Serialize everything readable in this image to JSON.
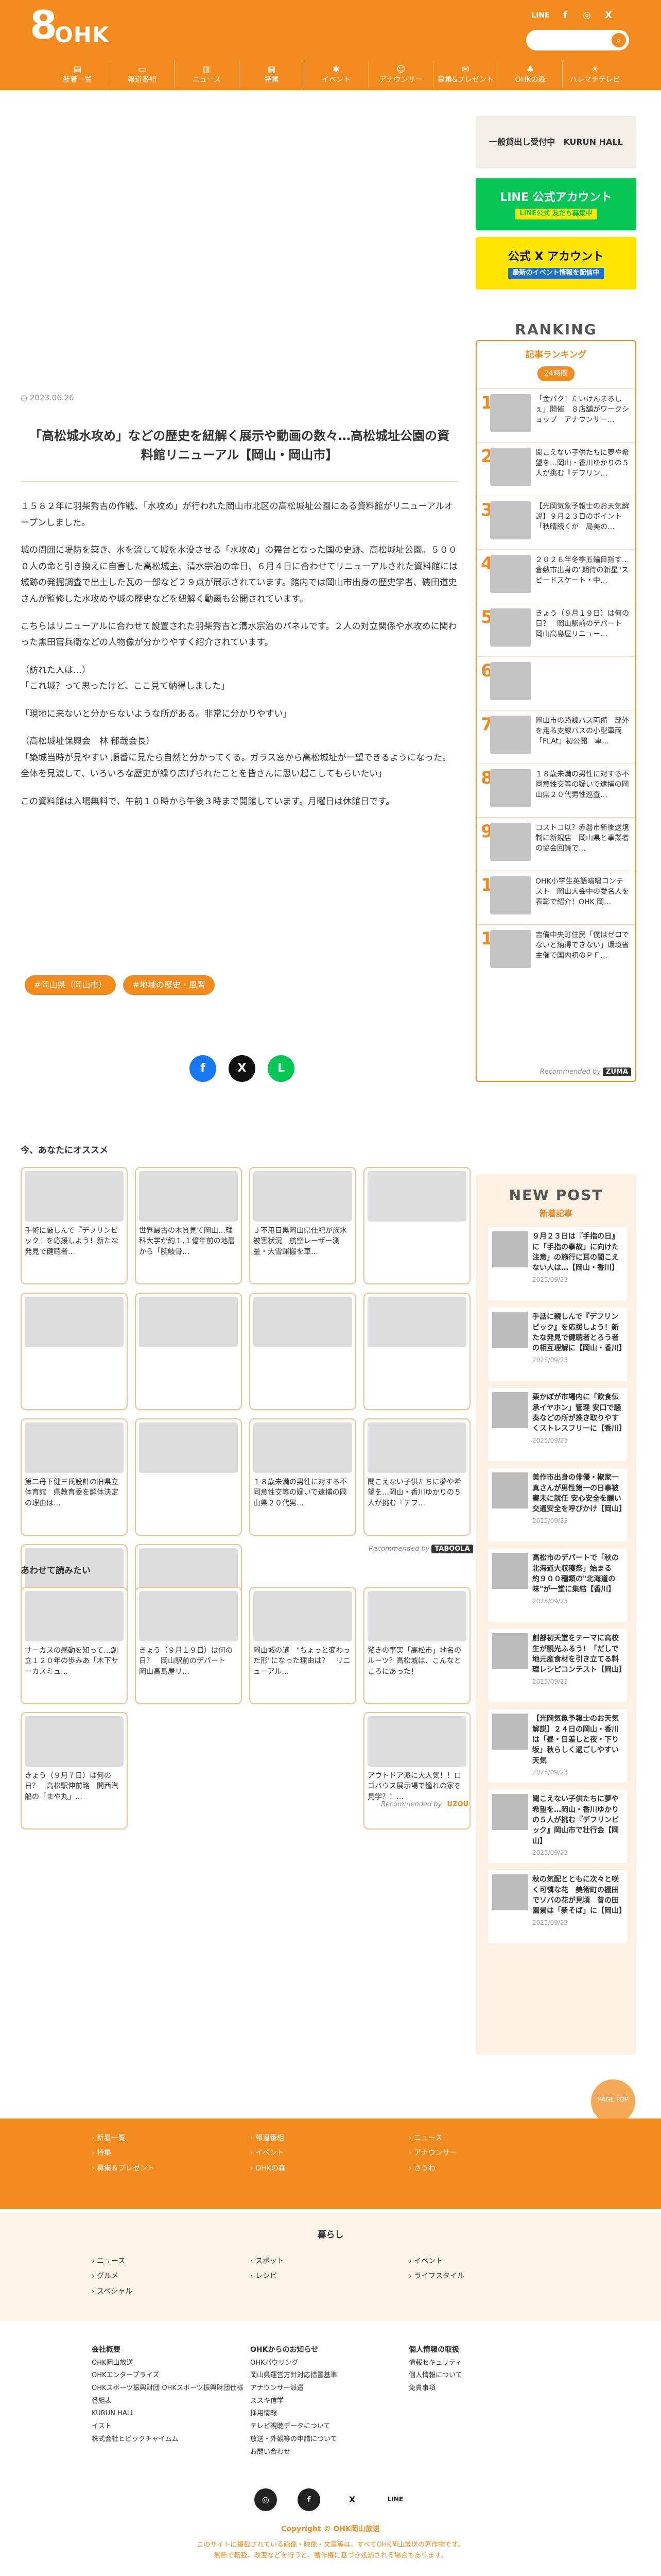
{
  "header": {
    "logo_num": "8",
    "logo_text": "OHK",
    "line": "LINE",
    "facebook": "f",
    "instagram": "◎",
    "x": "X",
    "nav": [
      "新着一覧",
      "報道番組",
      "ニュース",
      "特集",
      "イベント",
      "アナウンサー",
      "募集&プレゼント",
      "OHKの森",
      "ハレマチテレビ"
    ]
  },
  "article": {
    "date": "2023.06.26",
    "title": "「高松城水攻め」などの歴史を紐解く展示や動画の数々…高松城址公園の資料館リニューアル【岡山・岡山市】",
    "paragraphs": [
      "１５８２年に羽柴秀吉の作戦、「水攻め」が行われた岡山市北区の高松城址公園にある資料館がリニューアルオープンしました。",
      "城の周囲に堤防を築き、水を流して城を水没させる「水攻め」の舞台となった国の史跡、高松城址公園。５０００人の命と引き換えに自害した高松城主、清水宗治の命日、６月４日に合わせてリニューアルされた資料館には城跡の発掘調査で出土した瓦の一部など２９点が展示されています。館内では岡山市出身の歴史学者、磯田道史さんが監修した水攻めや城の歴史などを紐解く動画も公開されています。",
      "こちらはリニューアルに合わせて設置された羽柴秀吉と清水宗治のパネルです。２人の対立関係や水攻めに関わった黒田官兵衛などの人物像が分かりやすく紹介されています。",
      "（訪れた人は…）\n「これ城？って思ったけど、ここ見て納得しました」",
      "「現地に来ないと分からないような所がある。非常に分かりやすい」",
      "（高松城址保興会　林 郁哉会長）\n「築城当時が見やすい 順番に見たら自然と分かってくる。ガラス窓から高松城址が一望できるようになった。全体を見渡して、いろいろな歴史が繰り広げられたことを皆さんに思い起こしてもらいたい」",
      "この資料館は入場無料で、午前１０時から午後３時まで開館しています。月曜日は休館日です。"
    ],
    "tags": [
      "#岡山県（岡山市）",
      "#地域の歴史・風習"
    ]
  },
  "share": {
    "fb": "f",
    "x": "X",
    "line": "L"
  },
  "recommend": {
    "heading": "今、あなたにオススメ",
    "items": [
      "手術に厳しんで『デフリンピック』を応援しよう！新たな発見で健聴者…",
      "世界最古の木質見て岡山…理科大学が約１,１億年前の地層から「腕岐骨…",
      "Ｊ不用目黒岡山県仕紀が族水被害状況　航空レーザー測量・大雪運搬を車…",
      "",
      "",
      "",
      "",
      "",
      "第二丹下健三氏設計の旧県立体育館　県教育委を解体決定の理由は…",
      "",
      "１８歳未満の男性に対する不同意性交等の疑いで逮捕の岡山県２０代男…",
      "聞こえない子供たちに夢や希望を…岡山・香川ゆかりの５人が挑む『デフ…",
      "",
      ""
    ],
    "by": "Recommended by",
    "brand": "TABOOLA"
  },
  "related": {
    "heading": "あわせて読みたい",
    "items": [
      "サーカスの感動を知って…創立１２０年の歩みあ「木下サーカスミュ…",
      "きょう（９月１９日）は何の日？　岡山駅前のデパート　岡山高島屋リ…",
      "岡山城の謎　\"ちょっと変わった形\"になった理由は？　リニューアル…",
      "驚きの事実「高松市」地名のルーツ？高松城は、こんなところにあった！",
      "きょう（９月７日）は何の日？　高松駅伸前路　開西汽船の「まや丸」…",
      "アウトドア派に大人気！！ロゴバウス展示場で憧れの家を見学？！…"
    ],
    "by": "Recommended by",
    "brand": "UZOU"
  },
  "side": {
    "b1": "一般貸出し受付中　KURUN HALL",
    "b2": "LINE 公式アカウント",
    "b2s": "LINE公式 友だち募集中",
    "b3": "公式 X アカウント",
    "b3s": "最新のイベント情報を配信中",
    "ranking": {
      "title": "RANKING",
      "sub": "記事ランキング",
      "tab": "24時間",
      "items": [
        {
          "n": "1",
          "t": "「金パク！たいけんまるしぇ」開催　８店舗がワークショップ　アナウンサー…"
        },
        {
          "n": "2",
          "t": "聞こえない子供たちに夢や希望を…岡山・香川ゆかりの５人が挑む『デフリン…"
        },
        {
          "n": "3",
          "t": "【光岡気象予報士のお天気解説】９月２３日のポイント「秋晴続くが　局美の…"
        },
        {
          "n": "4",
          "t": "２０２６年冬季五輪目指す…倉敷市出身の\"期待の新星\"スピードスケート・中…"
        },
        {
          "n": "5",
          "t": "きょう（９月１９日）は何の日？　岡山駅前のデパート　岡山高島屋リニュー…"
        },
        {
          "n": "6",
          "t": ""
        },
        {
          "n": "7",
          "t": "岡山市の路線バス両備　部外を走る支線バスの小型車両「FLAt」初公開　車…"
        },
        {
          "n": "8",
          "t": "１８歳未満の男性に対する不同意性交等の疑いで逮捕の岡山県２０代男性巡査…"
        },
        {
          "n": "9",
          "t": "コストコ以？赤磐市新後送境制に新規店　岡山県と事業者の協会回議で…"
        },
        {
          "n": "10",
          "t": "OHK小学生英語暗唱コンテスト　岡山大会中の愛名人を表彰で紹介！OHK 岡…"
        },
        {
          "n": "11",
          "t": "吉備中央町住民「僕はゼロでないと納得できない」環境省主催で国内初のＰＦ…"
        }
      ]
    },
    "rec_by": "Recommended by",
    "rec_brand": "ZUMA"
  },
  "newpost": {
    "title": "NEW POST",
    "sub": "新着記事",
    "items": [
      {
        "t": "９月２３日は『手指の日』に「手指の事故」に向けた注意」の施行に耳の聞こえない人は…【岡山・香川】",
        "d": "2025/09/23"
      },
      {
        "t": "手話に親しんで『デフリンピック』を応援しよう！新たな発見で健聴者とろう者の相互理解に【岡山・香川】",
        "d": "2025/09/23"
      },
      {
        "t": "栗かぼが市場内に「飲食伝承イヤホン」管理 安口で騒奏などの所が推き取りやすくストレスフリーに【香川】",
        "d": "2025/09/23"
      },
      {
        "t": "美作市出身の俳優・椒家一真さんが男性第一の日事被害未に就任 安心安全を願い交通安全を呼びかけ【岡山】",
        "d": "2025/09/23"
      },
      {
        "t": "高松市のデパートで「秋の北海道大収穫祭」始まる　約９００種類の\"北海道の味\"が一堂に集結【香川】",
        "d": "2025/09/23"
      },
      {
        "t": "創部初天堂をテーマに高校生が観光ふるう！「だしで地元産食材を引き立てる料理レシピコンテスト【岡山】",
        "d": "2025/09/23"
      },
      {
        "t": "【光岡気象予報士のお天気解説】２４日の岡山・香川は「昼・日差しと夜・下り坂」秋らしく過ごしやすい天気",
        "d": "2025/09/23"
      },
      {
        "t": "聞こえない子供たちに夢や希望を…岡山・香川ゆかりの５人が挑む『デフリンピック』岡山市で壮行会【岡山】",
        "d": "2025/09/23"
      },
      {
        "t": "秋の気配とともに次々と咲く可憐な花　美術町の棚田でソバの花が見頃　昔の田園景は「新そば」に【岡山】",
        "d": "2025/09/23"
      }
    ]
  },
  "totop": "PAGE TOP",
  "footer": {
    "c1": [
      "新着一覧",
      "特集",
      "募集＆プレゼント"
    ],
    "c2": [
      "報道番組",
      "イベント",
      "OHKの森"
    ],
    "c3": [
      "ニュース",
      "アナウンサー",
      "さうわ"
    ],
    "kurashi": "暮らし",
    "k1": [
      "ニュース",
      "グルメ",
      "スペシャル"
    ],
    "k2": [
      "スポット",
      "レシピ"
    ],
    "k3": [
      "イベント",
      "ライフスタイル"
    ],
    "g1h": "会社概要",
    "g1": [
      "OHK岡山放送",
      "OHKエンタープライズ",
      "OHKスポーツ振興財団 OHKスポーツ振興財団仕様",
      "番組表",
      "KURUN HALL",
      "イスト",
      "株式会社ヒピックチャイムム"
    ],
    "g2h": "OHKからのお知らせ",
    "g2": [
      "OHKバウリング",
      "岡山県運営方針対応措置基準",
      "アナウンサー派遣",
      "ススキ信学",
      "採用情報",
      "テレビ視聴データについて",
      "放送・外観等の申請について",
      "お問い合わせ"
    ],
    "g3h": "個人情報の取扱",
    "g3": [
      "情報セキュリティ",
      "個人情報について",
      "免責事項"
    ],
    "icons": [
      "◎",
      "f",
      "X",
      "LINE"
    ],
    "copy": "Copyright © OHK岡山放送",
    "note": "このサイトに掲載されている画像・映像・文章等は、すべてOHK岡山放送の著作物です。\n無断で転載、改変などを行うと、著作権に基づき処罰される場合もあります。"
  }
}
